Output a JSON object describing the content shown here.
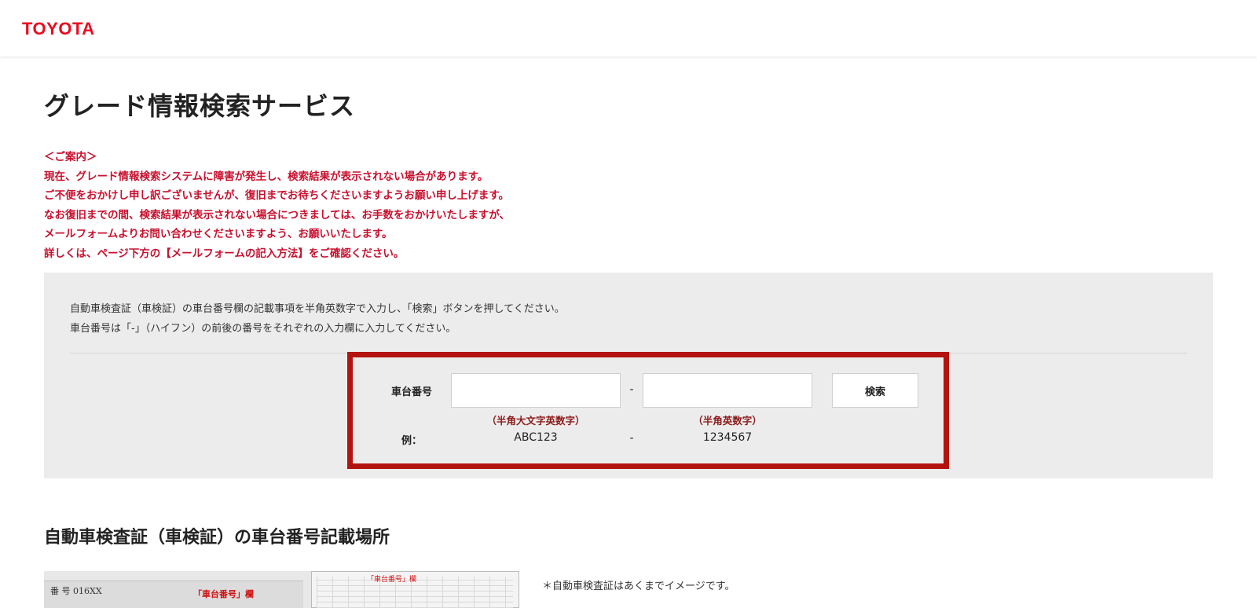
{
  "header": {
    "logo": "TOYOTA"
  },
  "colors": {
    "brand_red": "#eb0a1e",
    "notice_red": "#c8102e",
    "highlight_border": "#b3140f",
    "panel_bg": "#ececec"
  },
  "page": {
    "title": "グレード情報検索サービス"
  },
  "notice": {
    "lines": [
      "＜ご案内＞",
      "現在、グレード情報検索システムに障害が発生し、検索結果が表示されない場合があります。",
      "ご不便をおかけし申し訳ございませんが、復旧までお待ちくださいますようお願い申し上げます。",
      "なお復旧までの間、検索結果が表示されない場合につきましては、お手数をおかけいたしますが、",
      "メールフォームよりお問い合わせくださいますよう、お願いいたします。",
      "詳しくは、ページ下方の【メールフォームの記入方法】をご確認ください。"
    ]
  },
  "search": {
    "instructions": [
      "自動車検査証（車検証）の車台番号欄の記載事項を半角英数字で入力し、「検索」ボタンを押してください。",
      "車台番号は「-」（ハイフン）の前後の番号をそれぞれの入力欄に入力してください。"
    ],
    "chassis_label": "車台番号",
    "input1_value": "",
    "input2_value": "",
    "separator": "-",
    "button_label": "検索",
    "hint1": "（半角大文字英数字）",
    "hint2": "（半角英数字）",
    "example_label": "例：",
    "example1": "ABC123",
    "example2": "1234567"
  },
  "section": {
    "title": "自動車検査証（車検証）の車台番号記載場所",
    "image_left_text": "番 号  016XX",
    "image_left_red": "「車台番号」欄",
    "image_right_red": "「車台番号」欄",
    "note": "＊自動車検査証はあくまでイメージです。"
  }
}
